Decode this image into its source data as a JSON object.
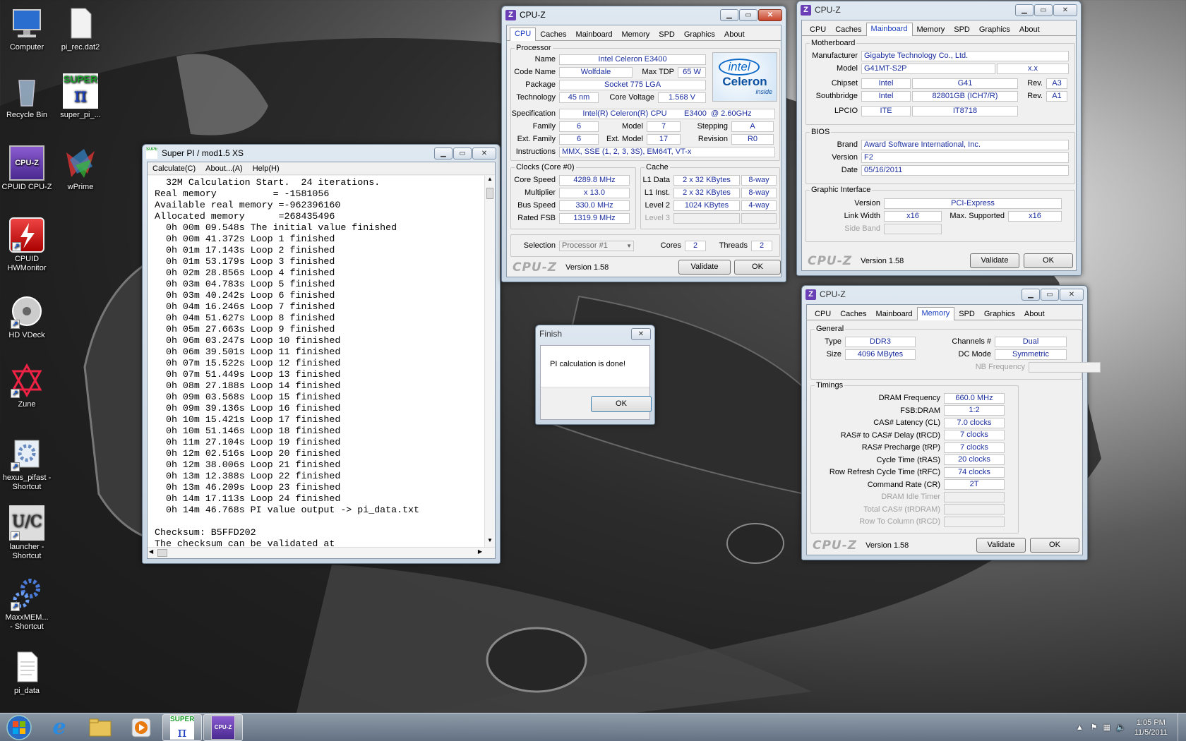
{
  "desktop": {
    "icons": [
      {
        "label": "Computer"
      },
      {
        "label": "pi_rec.dat2"
      },
      {
        "label": "Recycle Bin"
      },
      {
        "label": "super_pi_..."
      },
      {
        "label": "CPUID CPU-Z"
      },
      {
        "label": "wPrime"
      },
      {
        "label": "CPUID\nHWMonitor"
      },
      {
        "label": "HD VDeck"
      },
      {
        "label": "Zune"
      },
      {
        "label": "hexus_pifast -\nShortcut"
      },
      {
        "label": "launcher -\nShortcut"
      },
      {
        "label": "MaxxMEM...\n- Shortcut"
      },
      {
        "label": "pi_data"
      }
    ],
    "icon_texts": {
      "super": "SUPER",
      "pi": "π",
      "cpuz": "CPU-Z",
      "launcher_u": "U",
      "launcher_c": "C"
    }
  },
  "superpi": {
    "title": "Super PI / mod1.5 XS",
    "icon": "SUPER",
    "menu": [
      "Calculate(C)",
      "About...(A)",
      "Help(H)"
    ],
    "lines": [
      "  32M Calculation Start.  24 iterations.",
      "Real memory          = -1581056",
      "Available real memory =-962396160",
      "Allocated memory      =268435496",
      "  0h 00m 09.548s The initial value finished",
      "  0h 00m 41.372s Loop 1 finished",
      "  0h 01m 17.143s Loop 2 finished",
      "  0h 01m 53.179s Loop 3 finished",
      "  0h 02m 28.856s Loop 4 finished",
      "  0h 03m 04.783s Loop 5 finished",
      "  0h 03m 40.242s Loop 6 finished",
      "  0h 04m 16.246s Loop 7 finished",
      "  0h 04m 51.627s Loop 8 finished",
      "  0h 05m 27.663s Loop 9 finished",
      "  0h 06m 03.247s Loop 10 finished",
      "  0h 06m 39.501s Loop 11 finished",
      "  0h 07m 15.522s Loop 12 finished",
      "  0h 07m 51.449s Loop 13 finished",
      "  0h 08m 27.188s Loop 14 finished",
      "  0h 09m 03.568s Loop 15 finished",
      "  0h 09m 39.136s Loop 16 finished",
      "  0h 10m 15.421s Loop 17 finished",
      "  0h 10m 51.146s Loop 18 finished",
      "  0h 11m 27.104s Loop 19 finished",
      "  0h 12m 02.516s Loop 20 finished",
      "  0h 12m 38.006s Loop 21 finished",
      "  0h 13m 12.388s Loop 22 finished",
      "  0h 13m 46.209s Loop 23 finished",
      "  0h 14m 17.113s Loop 24 finished",
      "  0h 14m 46.768s PI value output -> pi_data.txt",
      "",
      "Checksum: B5FFD202",
      "The checksum can be validated at"
    ]
  },
  "finish": {
    "title": "Finish",
    "message": "PI calculation is done!",
    "ok": "OK"
  },
  "cpuz_common": {
    "title": "CPU-Z",
    "icon": "Z",
    "logo": "CPU-Z",
    "version": "Version 1.58",
    "validate": "Validate",
    "ok": "OK",
    "tabs": [
      "CPU",
      "Caches",
      "Mainboard",
      "Memory",
      "SPD",
      "Graphics",
      "About"
    ]
  },
  "cpu": {
    "processor_label": "Processor",
    "name_l": "Name",
    "name": "Intel Celeron E3400",
    "codename_l": "Code Name",
    "codename": "Wolfdale",
    "maxtdp_l": "Max TDP",
    "maxtdp": "65 W",
    "package_l": "Package",
    "package": "Socket 775 LGA",
    "tech_l": "Technology",
    "tech": "45 nm",
    "voltage_l": "Core Voltage",
    "voltage": "1.568 V",
    "spec_l": "Specification",
    "spec": "Intel(R) Celeron(R) CPU        E3400  @ 2.60GHz",
    "family_l": "Family",
    "family": "6",
    "model_l": "Model",
    "model": "7",
    "stepping_l": "Stepping",
    "stepping": "A",
    "extfamily_l": "Ext. Family",
    "extfamily": "6",
    "extmodel_l": "Ext. Model",
    "extmodel": "17",
    "revision_l": "Revision",
    "revision": "R0",
    "instr_l": "Instructions",
    "instr": "MMX, SSE (1, 2, 3, 3S), EM64T, VT-x",
    "clocks_label": "Clocks (Core #0)",
    "corespeed_l": "Core Speed",
    "corespeed": "4289.8 MHz",
    "mult_l": "Multiplier",
    "mult": "x 13.0",
    "bus_l": "Bus Speed",
    "bus": "330.0 MHz",
    "fsb_l": "Rated FSB",
    "fsb": "1319.9 MHz",
    "cache_label": "Cache",
    "l1d_l": "L1 Data",
    "l1d": "2 x 32 KBytes",
    "l1d_w": "8-way",
    "l1i_l": "L1 Inst.",
    "l1i": "2 x 32 KBytes",
    "l1i_w": "8-way",
    "l2_l": "Level 2",
    "l2": "1024 KBytes",
    "l2_w": "4-way",
    "l3_l": "Level 3",
    "sel_l": "Selection",
    "sel": "Processor #1",
    "cores_l": "Cores",
    "cores": "2",
    "threads_l": "Threads",
    "threads": "2",
    "badge_intel": "intel",
    "badge_celeron": "Celeron",
    "badge_inside": "inside"
  },
  "mainboard": {
    "mb_label": "Motherboard",
    "manuf_l": "Manufacturer",
    "manuf": "Gigabyte Technology Co., Ltd.",
    "model_l": "Model",
    "model": "G41MT-S2P",
    "model2": "x.x",
    "chipset_l": "Chipset",
    "chipset": "Intel",
    "chipset2": "G41",
    "rev_l": "Rev.",
    "rev1": "A3",
    "south_l": "Southbridge",
    "south": "Intel",
    "south2": "82801GB (ICH7/R)",
    "rev2": "A1",
    "lpcio_l": "LPCIO",
    "lpcio": "ITE",
    "lpcio2": "IT8718",
    "bios_label": "BIOS",
    "brand_l": "Brand",
    "brand": "Award Software International, Inc.",
    "bver_l": "Version",
    "bver": "F2",
    "date_l": "Date",
    "date": "05/16/2011",
    "gi_label": "Graphic Interface",
    "giver_l": "Version",
    "giver": "PCI-Express",
    "lw_l": "Link Width",
    "lw": "x16",
    "maxsup_l": "Max. Supported",
    "maxsup": "x16",
    "sideband_l": "Side Band"
  },
  "memory": {
    "gen_label": "General",
    "type_l": "Type",
    "type": "DDR3",
    "size_l": "Size",
    "size": "4096 MBytes",
    "ch_l": "Channels #",
    "ch": "Dual",
    "dc_l": "DC Mode",
    "dc": "Symmetric",
    "nb_l": "NB Frequency",
    "timings_label": "Timings",
    "timings": [
      {
        "l": "DRAM Frequency",
        "v": "660.0 MHz"
      },
      {
        "l": "FSB:DRAM",
        "v": "1:2"
      },
      {
        "l": "CAS# Latency (CL)",
        "v": "7.0 clocks"
      },
      {
        "l": "RAS# to CAS# Delay (tRCD)",
        "v": "7 clocks"
      },
      {
        "l": "RAS# Precharge (tRP)",
        "v": "7 clocks"
      },
      {
        "l": "Cycle Time (tRAS)",
        "v": "20 clocks"
      },
      {
        "l": "Row Refresh Cycle Time (tRFC)",
        "v": "74 clocks"
      },
      {
        "l": "Command Rate (CR)",
        "v": "2T"
      },
      {
        "l": "DRAM Idle Timer",
        "v": ""
      },
      {
        "l": "Total CAS# (tRDRAM)",
        "v": ""
      },
      {
        "l": "Row To Column (tRCD)",
        "v": ""
      }
    ]
  },
  "taskbar": {
    "time": "1:05 PM",
    "date": "11/5/2011",
    "super": "SUPER",
    "pi": "π",
    "cpuz": "CPU-Z"
  },
  "colors": {
    "value_text": "#1a2d9e",
    "active_tab": "#1a3ec0"
  }
}
